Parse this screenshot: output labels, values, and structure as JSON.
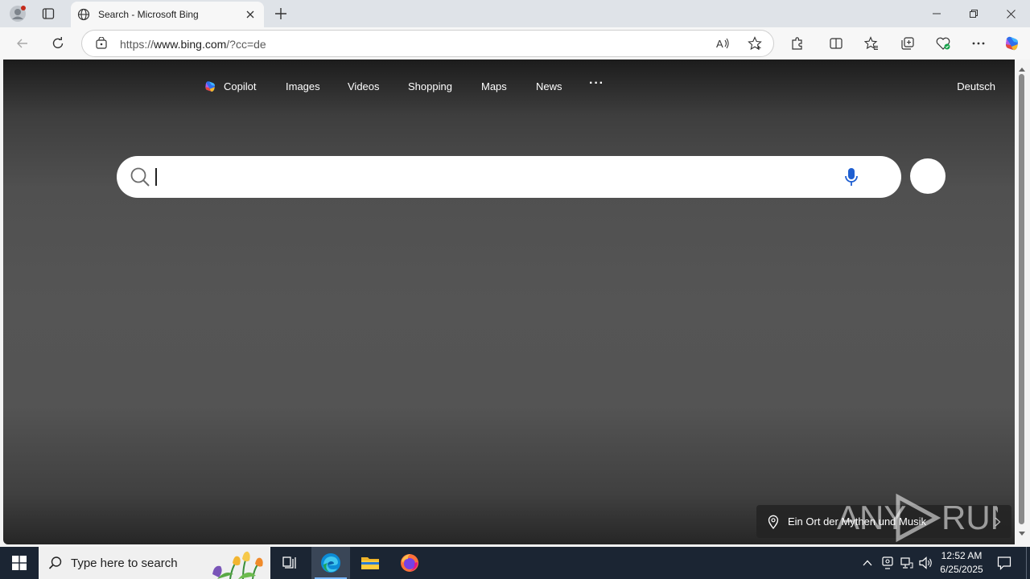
{
  "browser": {
    "tab_title": "Search - Microsoft Bing",
    "url_prefix": "https://",
    "url_host": "www.bing.com",
    "url_path": "/?cc=de"
  },
  "bing": {
    "nav": [
      "Copilot",
      "Images",
      "Videos",
      "Shopping",
      "Maps",
      "News"
    ],
    "more": "···",
    "language": "Deutsch",
    "location_text": "Ein Ort der Mythen und Musik"
  },
  "watermark": "ANY ▷ RUN",
  "taskbar": {
    "search_placeholder": "Type here to search",
    "time": "12:52 AM",
    "date": "6/25/2025"
  },
  "colors": {
    "accent": "#0078d4",
    "taskbar": "#1b2533",
    "copilot_red": "#e8463c"
  }
}
